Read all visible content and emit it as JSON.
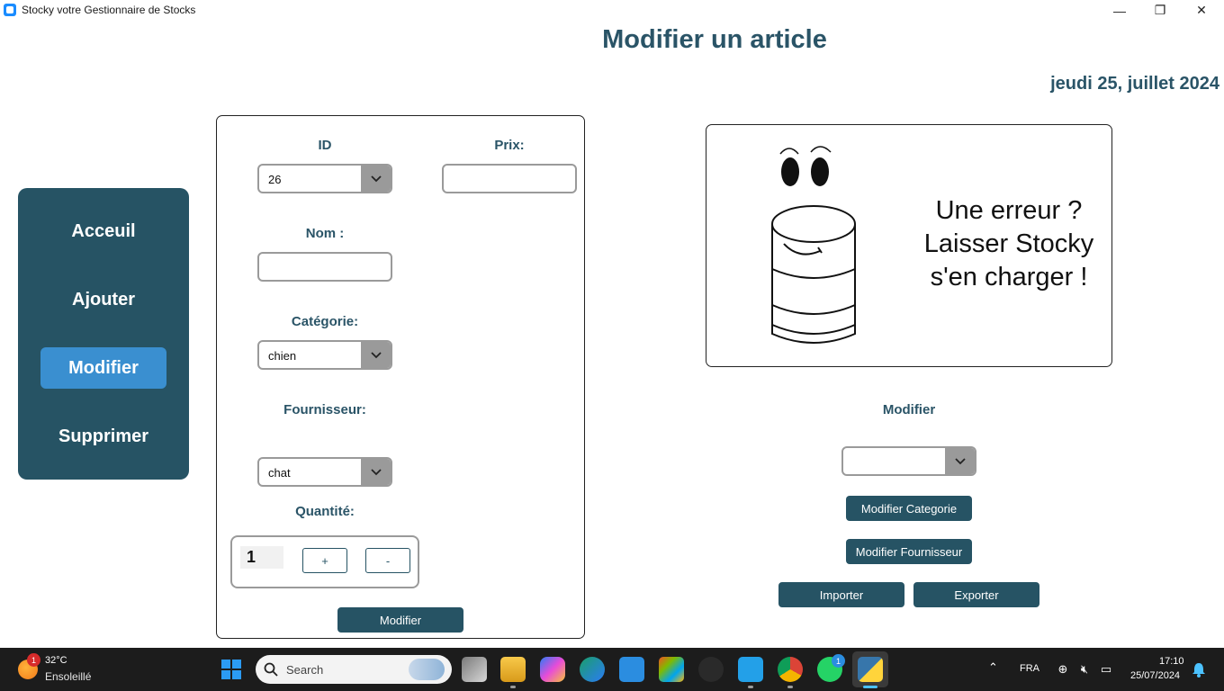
{
  "window": {
    "title": "Stocky votre Gestionnaire de Stocks",
    "minimize_glyph": "—",
    "maximize_glyph": "❐",
    "close_glyph": "✕"
  },
  "header": {
    "title": "Modifier un article",
    "date": "jeudi 25, juillet 2024"
  },
  "sidebar": {
    "items": [
      {
        "label": "Acceuil",
        "active": false
      },
      {
        "label": "Ajouter",
        "active": false
      },
      {
        "label": "Modifier",
        "active": true
      },
      {
        "label": "Supprimer",
        "active": false
      }
    ]
  },
  "form": {
    "id_label": "ID",
    "id_value": "26",
    "prix_label": "Prix:",
    "prix_value": "",
    "nom_label": "Nom :",
    "nom_value": "",
    "categorie_label": "Catégorie:",
    "categorie_value": "chien",
    "fournisseur_label": "Fournisseur:",
    "fournisseur_value": "chat",
    "quantite_label": "Quantité:",
    "quantite_value": "1",
    "plus_label": "+",
    "minus_label": "-",
    "submit_label": "Modifier"
  },
  "illustration": {
    "line1": "Une erreur ?",
    "line2": "Laisser Stocky",
    "line3": "s'en charger !"
  },
  "right_panel": {
    "label": "Modifier",
    "select_value": "",
    "modifier_categorie": "Modifier Categorie",
    "modifier_fournisseur": "Modifier Fournisseur",
    "importer": "Importer",
    "exporter": "Exporter"
  },
  "taskbar": {
    "weather_badge": "1",
    "weather_temp": "32°C",
    "weather_desc": "Ensoleillé",
    "search_placeholder": "Search",
    "whatsapp_badge": "1",
    "language": "FRA",
    "time": "17:10",
    "date": "25/07/2024",
    "colors": {
      "background": "#1c1c1c",
      "accent": "#4cc2ff"
    }
  },
  "colors": {
    "primary": "#265364",
    "active_nav": "#3a8fd0",
    "heading": "#2a5467"
  }
}
